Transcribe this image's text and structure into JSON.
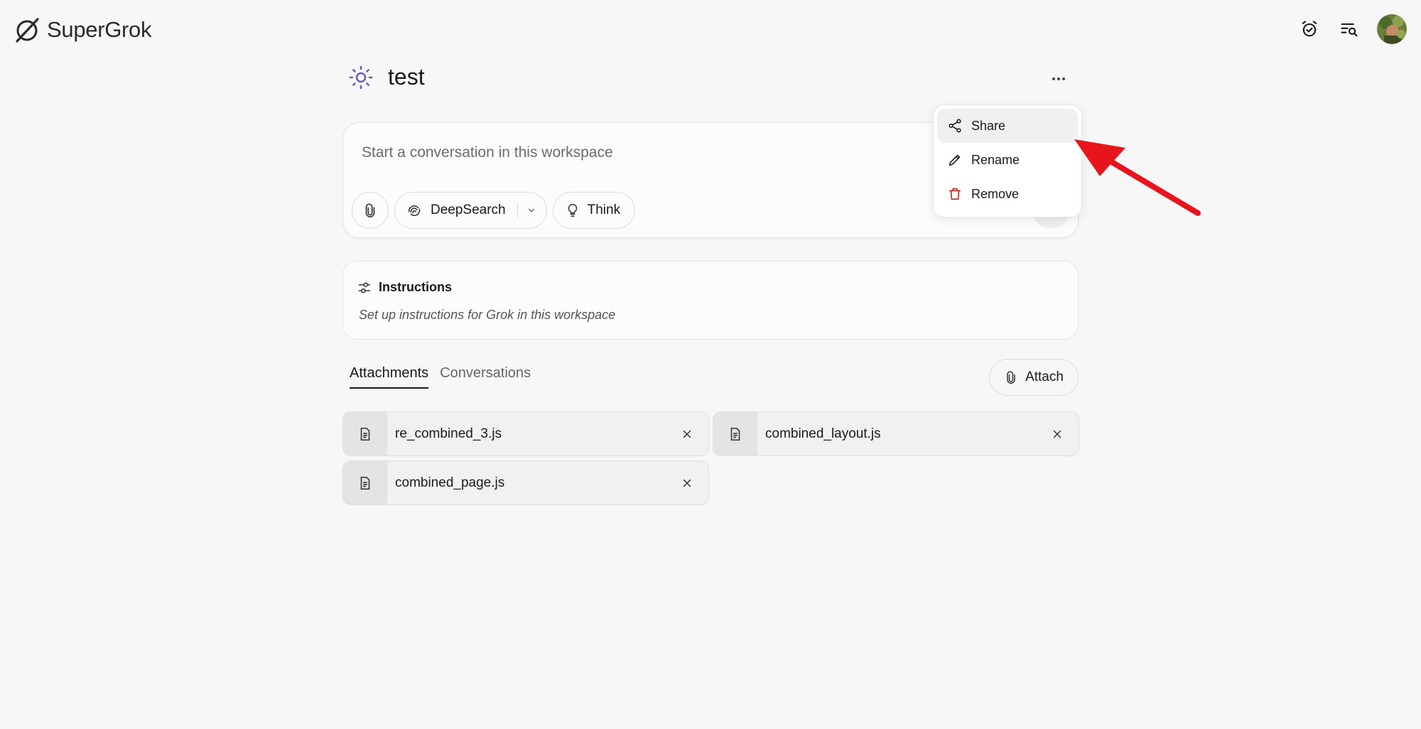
{
  "app": {
    "name": "SuperGrok"
  },
  "header": {
    "icons": [
      "alarm-check-icon",
      "search-list-icon"
    ],
    "avatar": "user-avatar"
  },
  "workspace": {
    "icon": "sun-icon",
    "name": "test",
    "more_icon": "more-horizontal-icon"
  },
  "composer": {
    "placeholder": "Start a conversation in this workspace",
    "tools": {
      "attach_icon": "paperclip-icon",
      "deepsearch_label": "DeepSearch",
      "think_label": "Think"
    }
  },
  "menu": {
    "items": [
      {
        "label": "Share",
        "icon": "share-icon",
        "active": true
      },
      {
        "label": "Rename",
        "icon": "pencil-icon"
      },
      {
        "label": "Remove",
        "icon": "trash-icon",
        "color": "#b3261e"
      }
    ]
  },
  "instructions": {
    "title": "Instructions",
    "subtitle": "Set up instructions for Grok in this workspace"
  },
  "tabs": [
    {
      "label": "Attachments",
      "active": true
    },
    {
      "label": "Conversations",
      "active": false
    }
  ],
  "attach_button": {
    "label": "Attach"
  },
  "files": [
    {
      "name": "re_combined_3.js"
    },
    {
      "name": "combined_layout.js"
    },
    {
      "name": "combined_page.js"
    }
  ],
  "colors": {
    "background": "#f7f7f7",
    "accent_icon": "#6a5fc1",
    "danger": "#b3261e",
    "annotation_arrow": "#e8141c"
  }
}
